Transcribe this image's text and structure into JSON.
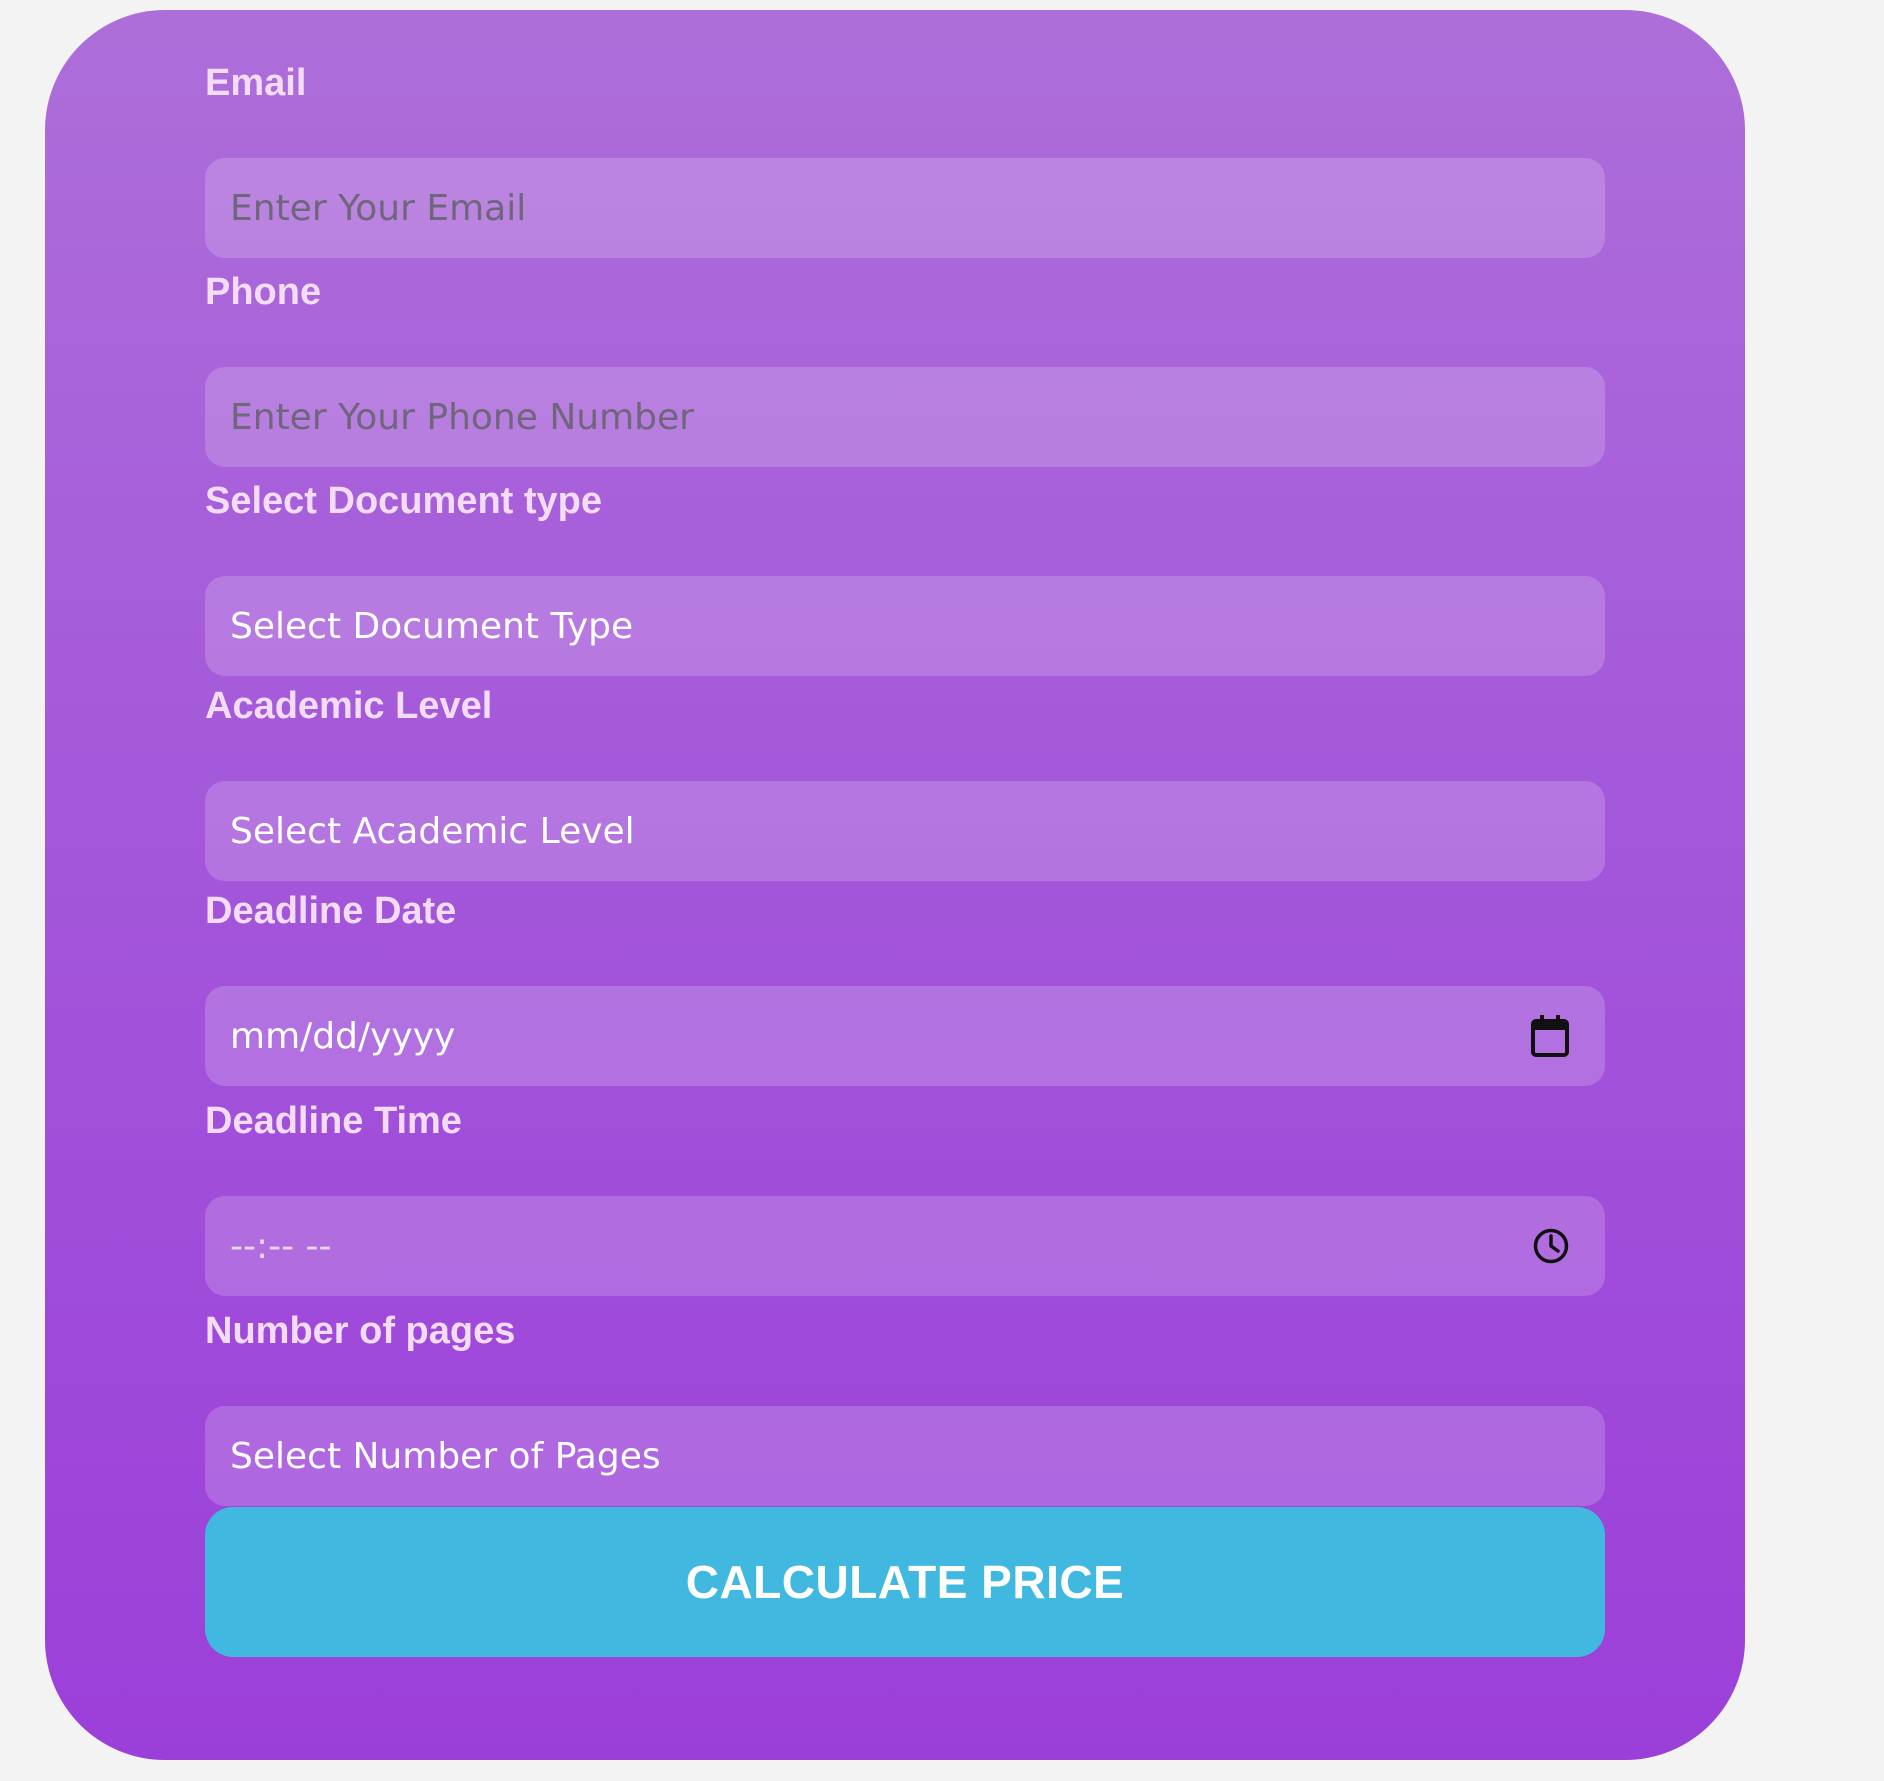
{
  "form": {
    "email": {
      "label": "Email",
      "placeholder": "Enter Your Email"
    },
    "phone": {
      "label": "Phone",
      "placeholder": "Enter Your Phone Number"
    },
    "document_type": {
      "label": "Select Document type",
      "selected": "Select Document Type"
    },
    "academic_level": {
      "label": "Academic Level",
      "selected": "Select Academic Level"
    },
    "deadline_date": {
      "label": "Deadline Date",
      "value": "mm/dd/yyyy",
      "icon": "calendar-icon"
    },
    "deadline_time": {
      "label": "Deadline Time",
      "value": "--:-- --",
      "icon": "clock-icon"
    },
    "pages": {
      "label": "Number of pages",
      "selected": "Select Number of Pages"
    },
    "submit_label": "CALCULATE PRICE"
  },
  "colors": {
    "page_background": "#f3f3f3",
    "card_gradient_top": "#ad6ed9",
    "card_gradient_bottom": "#9b3fd9",
    "label": "#f2dcf7",
    "button": "#41b8df",
    "button_text": "#ffffff"
  }
}
